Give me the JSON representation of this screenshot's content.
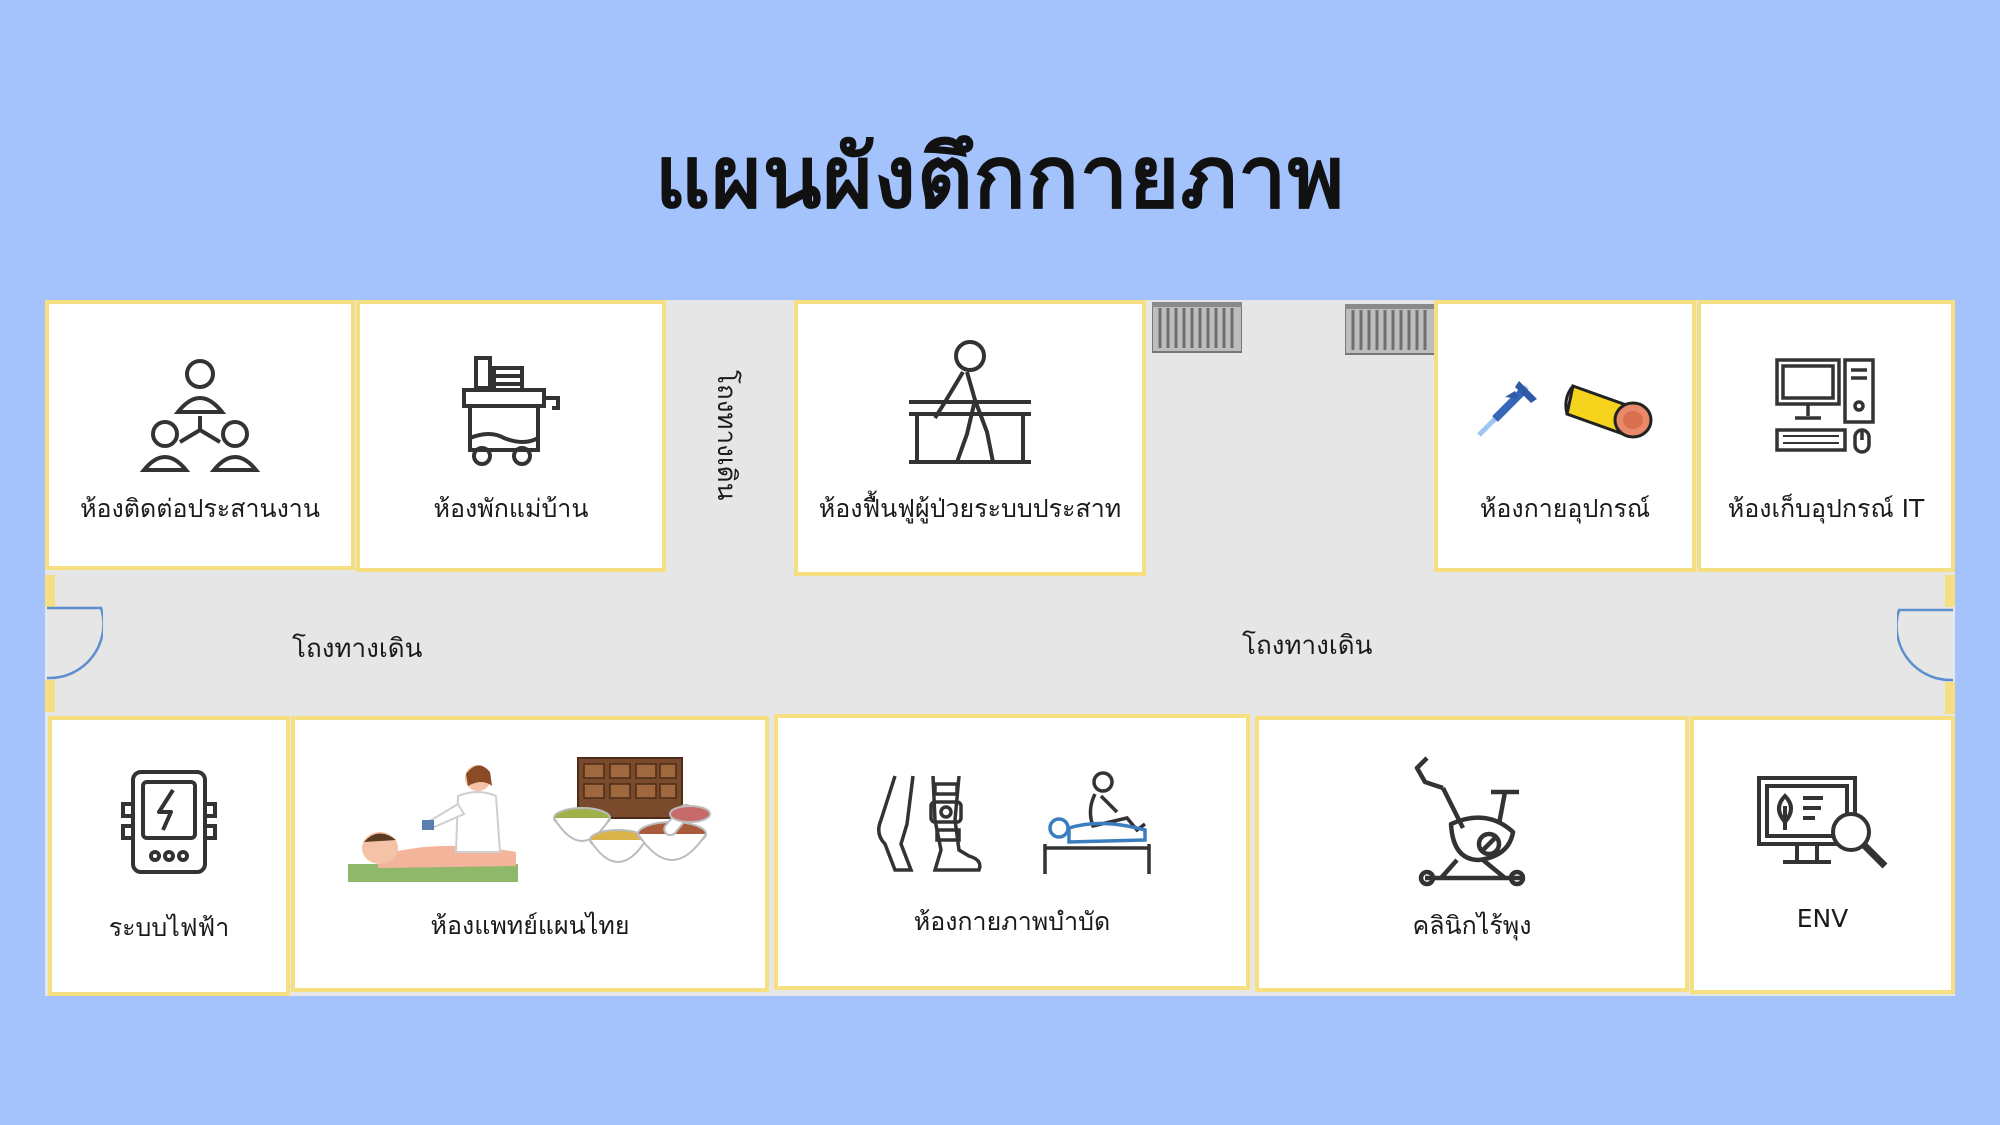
{
  "title": "แผนผังตึกกายภาพ",
  "rooms_top": [
    {
      "label": "ห้องติดต่อประสานงาน",
      "icon": "team-network-icon"
    },
    {
      "label": "ห้องพักแม่บ้าน",
      "icon": "cleaning-cart-icon"
    },
    {
      "label": "ห้องฟื้นฟูผู้ป่วยระบบประสาท",
      "icon": "parallel-bars-walking-icon"
    },
    {
      "label": "ห้องกายอุปกรณ์",
      "icons": [
        "caliper-icon",
        "exercise-mat-icon"
      ]
    },
    {
      "label": "ห้องเก็บอุปกรณ์ IT",
      "icon": "desktop-computer-icon"
    }
  ],
  "rooms_bottom": [
    {
      "label": "ระบบไฟฟ้า",
      "icon": "electrical-panel-icon"
    },
    {
      "label": "ห้องแพทย์แผนไทย",
      "icons": [
        "thai-massage-icon",
        "herbal-medicine-icon"
      ]
    },
    {
      "label": "ห้องกายภาพบำบัด",
      "icons": [
        "knee-brace-icon",
        "physiotherapy-treatment-icon"
      ]
    },
    {
      "label": "คลินิกไร้พุง",
      "icon": "exercise-bike-icon"
    },
    {
      "label": "ENV",
      "icon": "environment-report-icon"
    }
  ],
  "corridors": {
    "vertical": "โถงทางเดิน",
    "left": "โถงทางเดิน",
    "right": "โถงทางเดิน"
  },
  "colors": {
    "background": "#a4c2fc",
    "floor": "#e6e6e6",
    "room_border": "#f6df80",
    "door": "#5b8fd0"
  }
}
